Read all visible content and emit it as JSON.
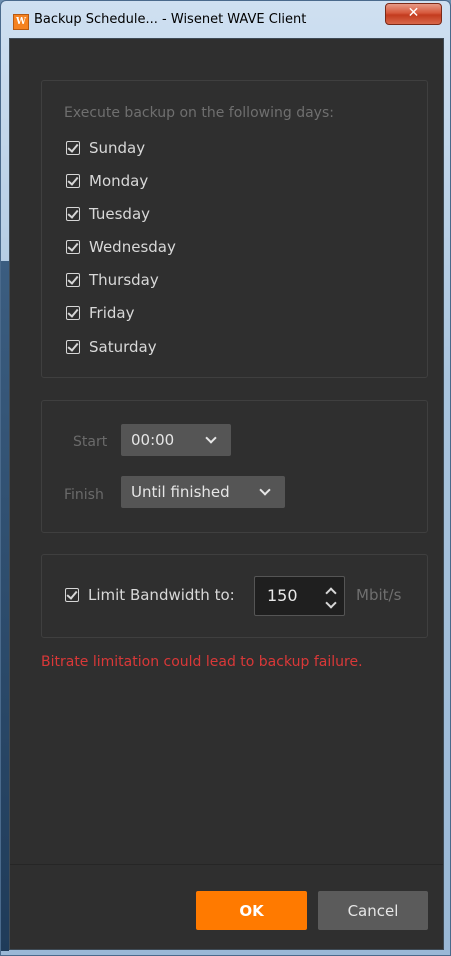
{
  "window": {
    "title": "Backup Schedule... - Wisenet WAVE Client",
    "app_icon_letter": "W",
    "close_glyph": "✕"
  },
  "days": {
    "title": "Execute backup on the following days:",
    "items": [
      {
        "label": "Sunday",
        "checked": true
      },
      {
        "label": "Monday",
        "checked": true
      },
      {
        "label": "Tuesday",
        "checked": true
      },
      {
        "label": "Wednesday",
        "checked": true
      },
      {
        "label": "Thursday",
        "checked": true
      },
      {
        "label": "Friday",
        "checked": true
      },
      {
        "label": "Saturday",
        "checked": true
      }
    ]
  },
  "schedule": {
    "start_label": "Start",
    "start_value": "00:00",
    "finish_label": "Finish",
    "finish_value": "Until finished"
  },
  "bandwidth": {
    "checkbox_label": "Limit Bandwidth to:",
    "checked": true,
    "value": "150",
    "unit": "Mbit/s"
  },
  "warning": "Bitrate limitation could lead to backup failure.",
  "buttons": {
    "ok": "OK",
    "cancel": "Cancel"
  },
  "colors": {
    "accent": "#ff7a00",
    "warning": "#d93838",
    "background": "#2f2f2f"
  }
}
